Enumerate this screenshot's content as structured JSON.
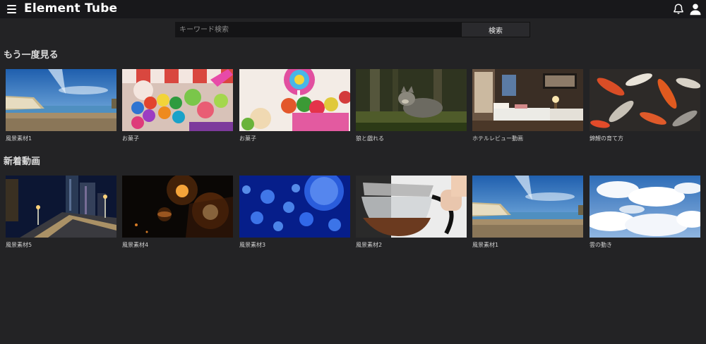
{
  "header": {
    "title": "Element Tube",
    "menu_icon": "hamburger-menu-icon",
    "notification_icon": "bell-icon",
    "account_icon": "user-icon"
  },
  "search": {
    "placeholder": "キーワード検索",
    "value": "",
    "button_label": "検索"
  },
  "sections": [
    {
      "title": "もう一度見る",
      "videos": [
        {
          "title": "風景素材1",
          "thumb": "coast"
        },
        {
          "title": "お菓子",
          "thumb": "candy"
        },
        {
          "title": "お菓子",
          "thumb": "candy2"
        },
        {
          "title": "狼と戯れる",
          "thumb": "wolf"
        },
        {
          "title": "ホテルレビュー動画",
          "thumb": "hotel"
        },
        {
          "title": "錦鯉の育て方",
          "thumb": "koi"
        }
      ]
    },
    {
      "title": "新着動画",
      "videos": [
        {
          "title": "風景素材5",
          "thumb": "city"
        },
        {
          "title": "風景素材4",
          "thumb": "candles"
        },
        {
          "title": "風景素材3",
          "thumb": "jelly"
        },
        {
          "title": "風景素材2",
          "thumb": "coffee"
        },
        {
          "title": "風景素材1",
          "thumb": "coast"
        },
        {
          "title": "雲の動き",
          "thumb": "clouds"
        }
      ]
    }
  ],
  "colors": {
    "background": "#232325",
    "header": "#18181b",
    "search_field": "#141416"
  }
}
